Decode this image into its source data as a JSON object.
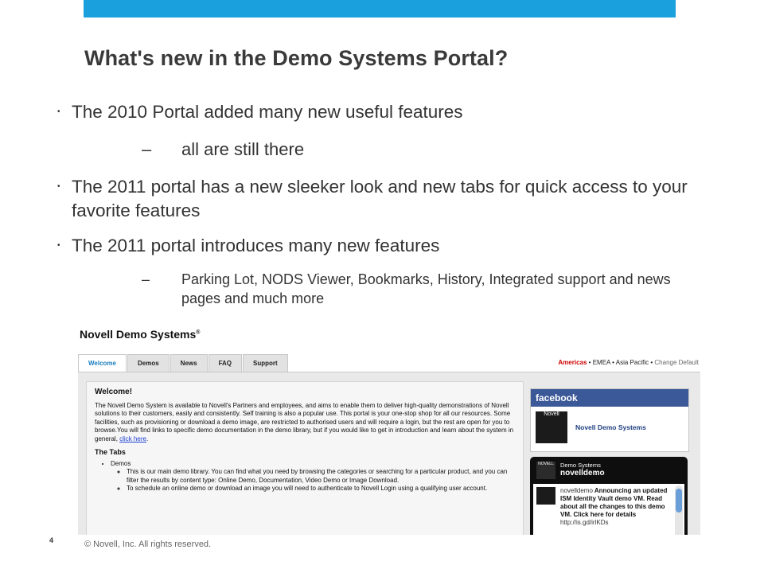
{
  "slide": {
    "title": "What's new in the Demo Systems Portal?",
    "bullet_glyph": "•",
    "dash_glyph": "–",
    "bullets": [
      {
        "text": "The 2010 Portal added many new useful features"
      },
      {
        "text": "all are still there"
      },
      {
        "text": "The 2011 portal has a new sleeker look and new tabs for quick access to your favorite features"
      },
      {
        "text": "The 2011 portal introduces many new features"
      },
      {
        "text": "Parking Lot, NODS Viewer, Bookmarks, History, Integrated support and news pages and much more"
      }
    ],
    "page_number": "4",
    "copyright": "© Novell, Inc.  All rights reserved."
  },
  "portal": {
    "brand": "Novell Demo Systems",
    "brand_mark": "®",
    "tabs": [
      {
        "label": "Welcome",
        "active": true
      },
      {
        "label": "Demos"
      },
      {
        "label": "News"
      },
      {
        "label": "FAQ"
      },
      {
        "label": "Support"
      }
    ],
    "regions": {
      "americas": "Americas",
      "sep": "•",
      "emea": "EMEA",
      "asia": "Asia Pacific",
      "change": "Change Default"
    },
    "welcome": {
      "heading": "Welcome!",
      "para": "The Novell Demo System is available to Novell's Partners and employees, and aims to enable them to deliver high-quality demonstrations of Novell solutions to their customers, easily and consistently. Self training is also a popular use. This portal is your one-stop shop for all our resources. Some facilities, such as provisioning or download a demo image, are restricted to authorised users and will require a login, but the rest are open for you to browse.You will find links to specific demo documentation in the demo library, but if you would like to get in introduction and learn about the system in general,",
      "link": "click here",
      "tabs_heading": "The Tabs",
      "demos_label": "Demos",
      "sub1": "This is our main demo library. You can find what you need by browsing the categories or searching for a particular product, and you can filter the results by content type: Online Demo, Documentation, Video Demo or Image Download.",
      "sub2": "To schedule an online demo or download an image you will need to authenticate to Novell Login using a qualifying user account."
    },
    "facebook": {
      "header": "facebook",
      "thumb_label": "Novell",
      "page_name": "Novell Demo Systems"
    },
    "twitter": {
      "logo_text": "NOVELL",
      "subtitle": "Demo Systems",
      "username": "novelldemo",
      "tweet_user": "novelldemo",
      "tweet_text": "Announcing an updated ISM Identity Vault demo VM. Read about all the changes to this demo VM. Click here for details",
      "tweet_link": "http://is.gd/irlKDs"
    }
  }
}
